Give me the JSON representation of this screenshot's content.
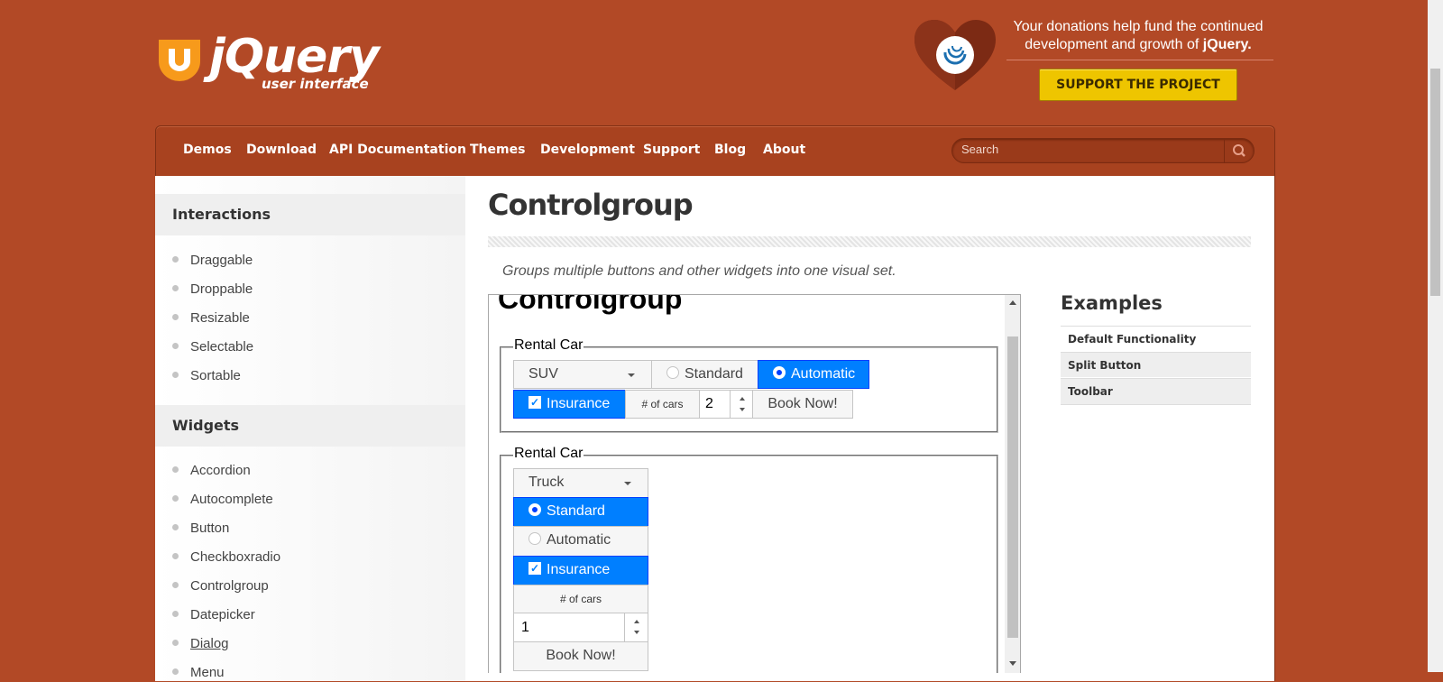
{
  "header": {
    "logo_word": "jQuery",
    "logo_sub": "user interface",
    "donate_line1": "Your donations help fund the continued",
    "donate_line2": "development and growth of",
    "donate_brand": "jQuery.",
    "support_label": "SUPPORT THE PROJECT"
  },
  "nav": {
    "items": [
      "Demos",
      "Download",
      "API Documentation",
      "Themes",
      "Development",
      "Support",
      "Blog",
      "About"
    ],
    "search_placeholder": "Search"
  },
  "sidebar": {
    "interactions_title": "Interactions",
    "interactions": [
      "Draggable",
      "Droppable",
      "Resizable",
      "Selectable",
      "Sortable"
    ],
    "widgets_title": "Widgets",
    "widgets": [
      "Accordion",
      "Autocomplete",
      "Button",
      "Checkboxradio",
      "Controlgroup",
      "Datepicker",
      "Dialog",
      "Menu"
    ]
  },
  "main": {
    "title": "Controlgroup",
    "description": "Groups multiple buttons and other widgets into one visual set."
  },
  "demo": {
    "heading": "Controlgroup",
    "group1": {
      "legend": "Rental Car",
      "select_value": "SUV",
      "radio_standard": "Standard",
      "radio_automatic": "Automatic",
      "insurance": "Insurance",
      "cars_label": "# of cars",
      "cars_value": "2",
      "book": "Book Now!"
    },
    "group2": {
      "legend": "Rental Car",
      "select_value": "Truck",
      "radio_standard": "Standard",
      "radio_automatic": "Automatic",
      "insurance": "Insurance",
      "cars_label": "# of cars",
      "cars_value": "1",
      "book": "Book Now!"
    }
  },
  "examples": {
    "title": "Examples",
    "items": [
      "Default Functionality",
      "Split Button",
      "Toolbar"
    ]
  },
  "colors": {
    "brand_bg": "#b24926",
    "active_blue": "#007fff",
    "support_yellow": "#eec500"
  }
}
